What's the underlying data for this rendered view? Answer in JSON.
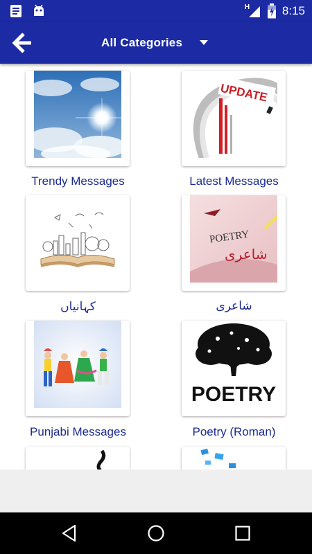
{
  "status_bar": {
    "time": "8:15",
    "network_label": "H"
  },
  "app_bar": {
    "title": "All Categories"
  },
  "categories": [
    {
      "label": "Trendy Messages"
    },
    {
      "label": "Latest Messages"
    },
    {
      "label": "کہانیاں"
    },
    {
      "label": "شاعری"
    },
    {
      "label": "Punjabi Messages"
    },
    {
      "label": "Poetry (Roman)"
    }
  ],
  "thumbs": {
    "update": "UPDATE",
    "poetry": "POETRY",
    "shairi": "شاعری",
    "poetry_big": "POETRY"
  },
  "colors": {
    "primary": "#1c2aa3",
    "label": "#1a2b93",
    "nav": "#000000"
  }
}
